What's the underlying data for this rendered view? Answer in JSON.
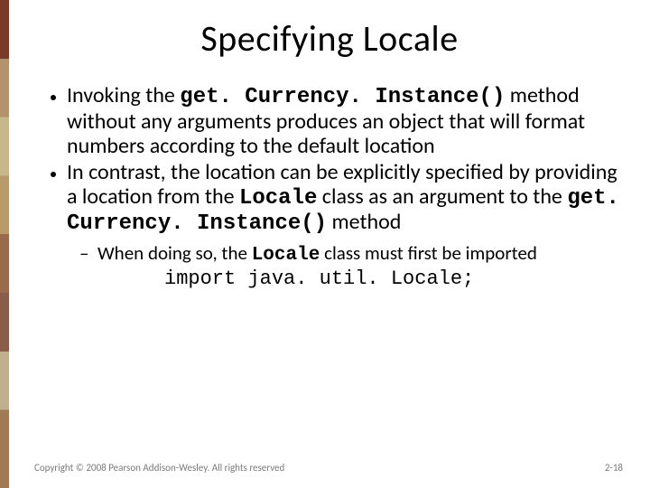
{
  "title": "Specifying Locale",
  "bullets": {
    "b1": {
      "pre": "Invoking the ",
      "code": "get. Currency. Instance()",
      "post": " method without any arguments produces an object that will format numbers according to the default location"
    },
    "b2": {
      "pre": "In contrast, the location can be explicitly specified by providing a location from the ",
      "code1": "Locale",
      "mid": " class as an argument to the ",
      "code2": "get. Currency. Instance()",
      "post": " method"
    },
    "sub1": {
      "pre": "When doing so, the ",
      "code": "Locale",
      "post": " class must first be imported"
    },
    "import_stmt": "import java. util. Locale;"
  },
  "footer": {
    "copyright": "Copyright © 2008 Pearson Addison-Wesley. All rights reserved",
    "page": "2-18"
  }
}
